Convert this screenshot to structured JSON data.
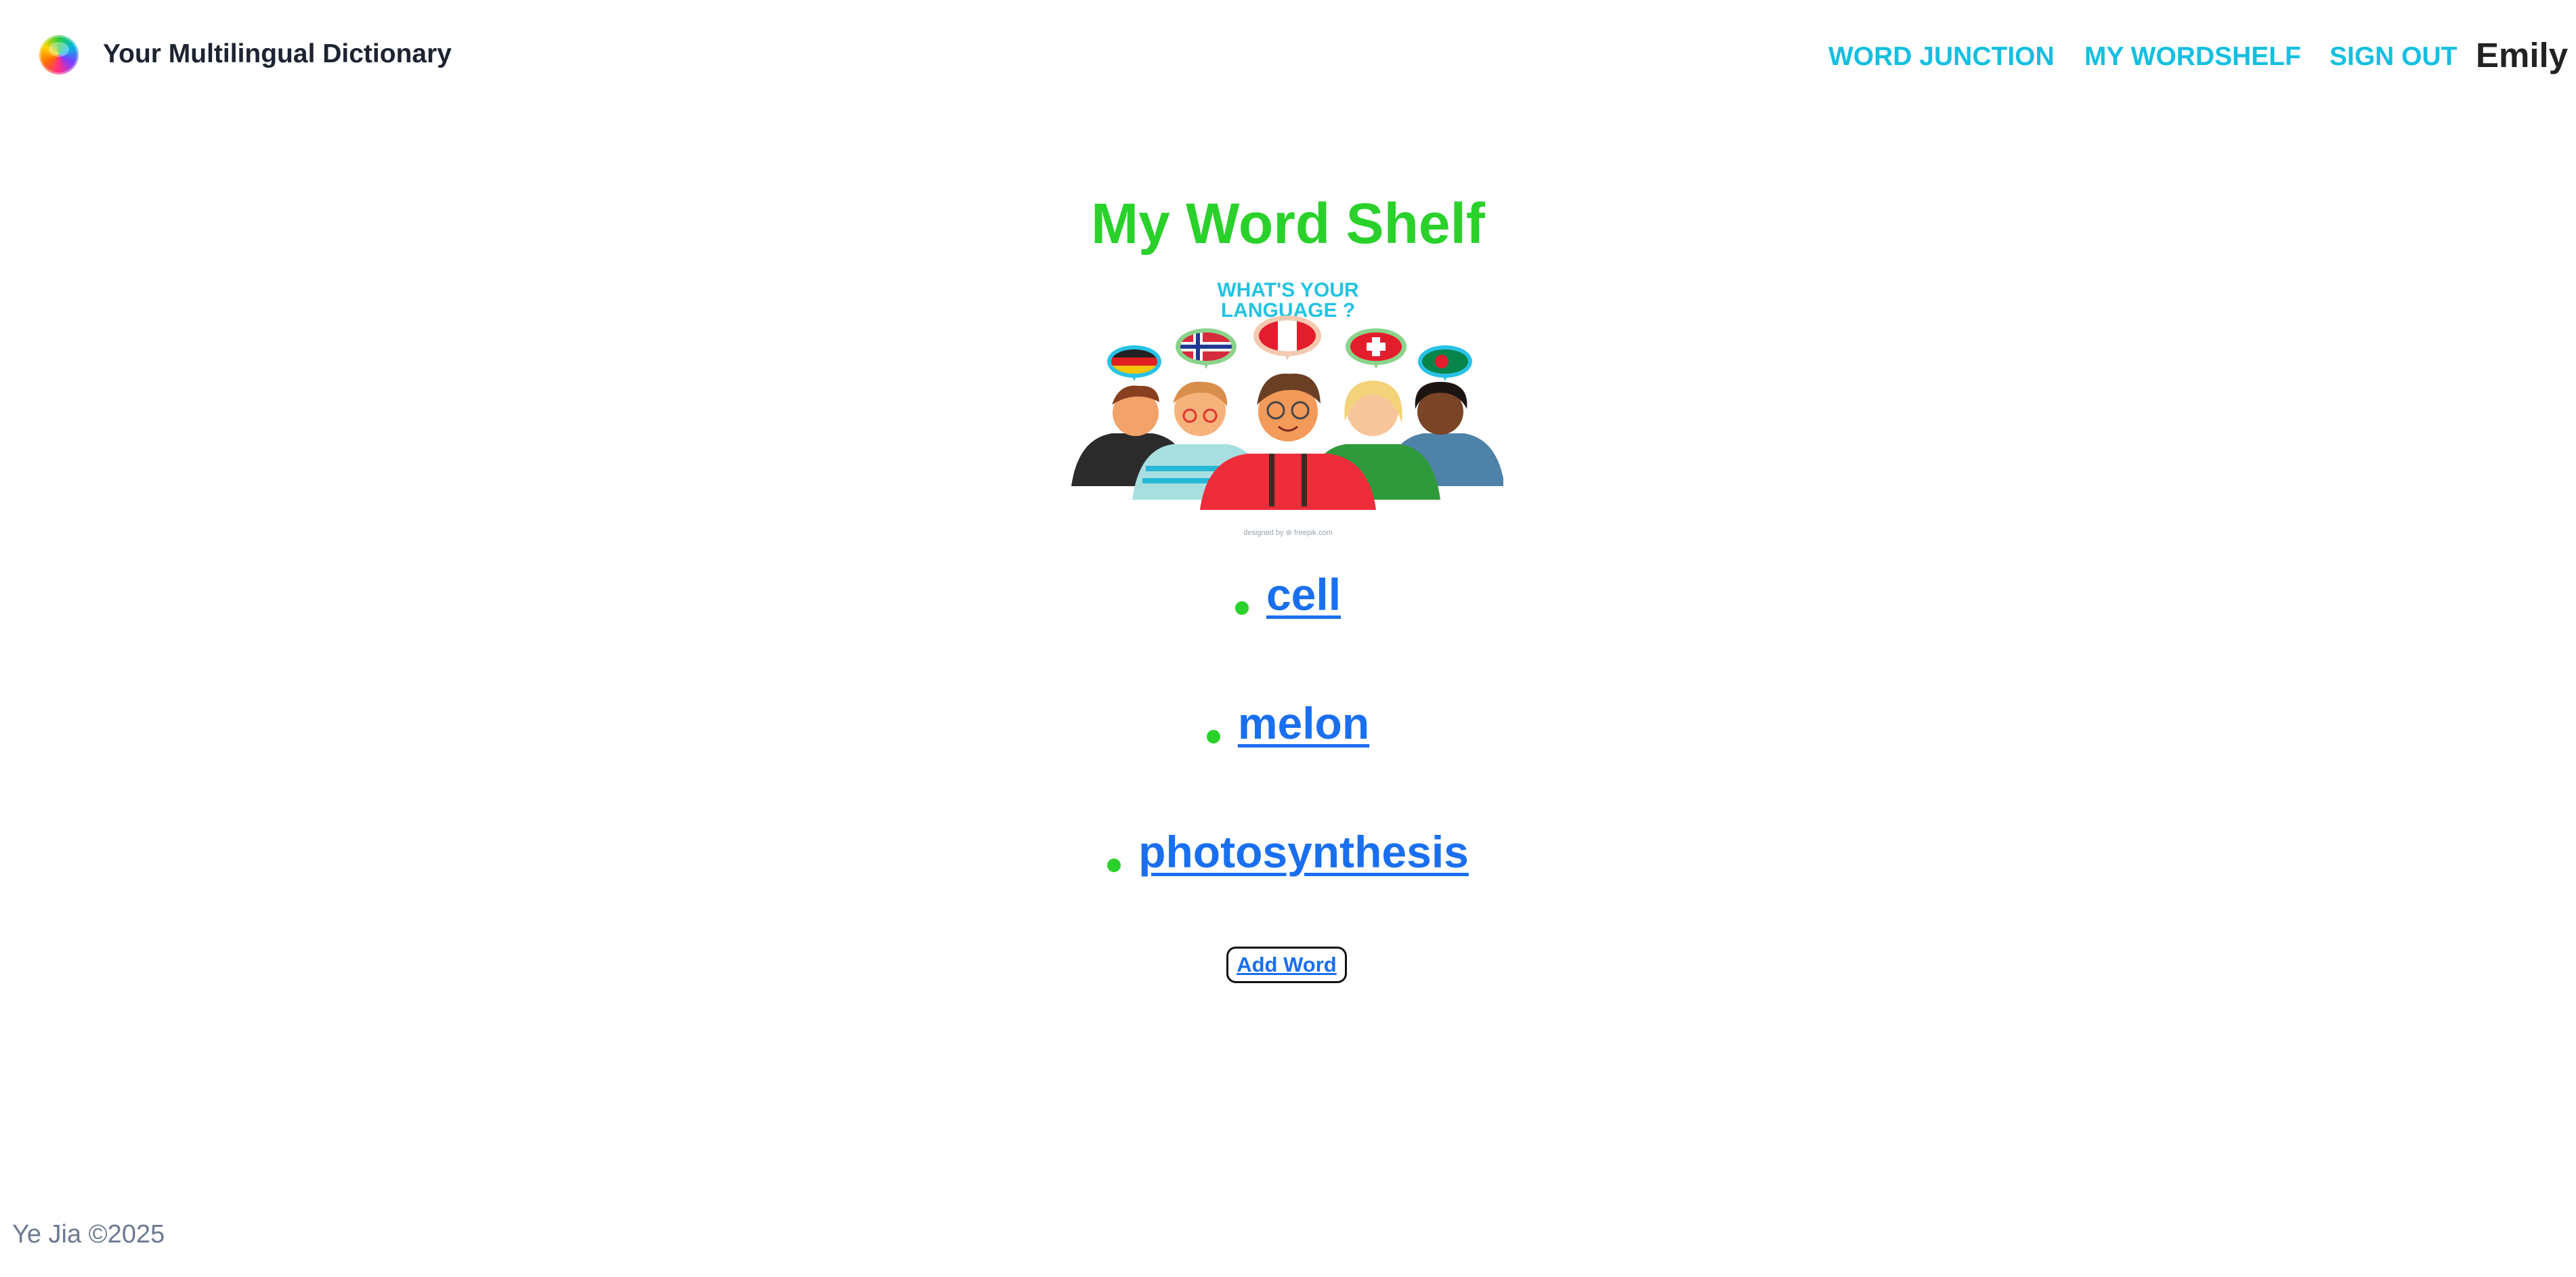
{
  "header": {
    "brand": "Your Multilingual Dictionary",
    "nav": {
      "word_junction": "WORD JUNCTION",
      "my_wordshelf": "MY WORDSHELF",
      "sign_out": "SIGN OUT"
    },
    "username": "Emily"
  },
  "main": {
    "title": "My Word Shelf",
    "hero": {
      "heading_line1": "WHAT'S YOUR",
      "heading_line2": "LANGUAGE ?",
      "credit": "designed by ⊛ freepik.com"
    },
    "words": [
      "cell",
      "melon",
      "photosynthesis"
    ],
    "add_word_label": "Add Word"
  },
  "footer": {
    "text": "Ye Jia ©2025"
  },
  "colors": {
    "accent_green": "#2ad12a",
    "nav_cyan": "#14bfe0",
    "link_blue": "#1a6ff0"
  },
  "icons": {
    "logo": "rainbow-globe-icon",
    "bullet": "green-dot-icon"
  }
}
